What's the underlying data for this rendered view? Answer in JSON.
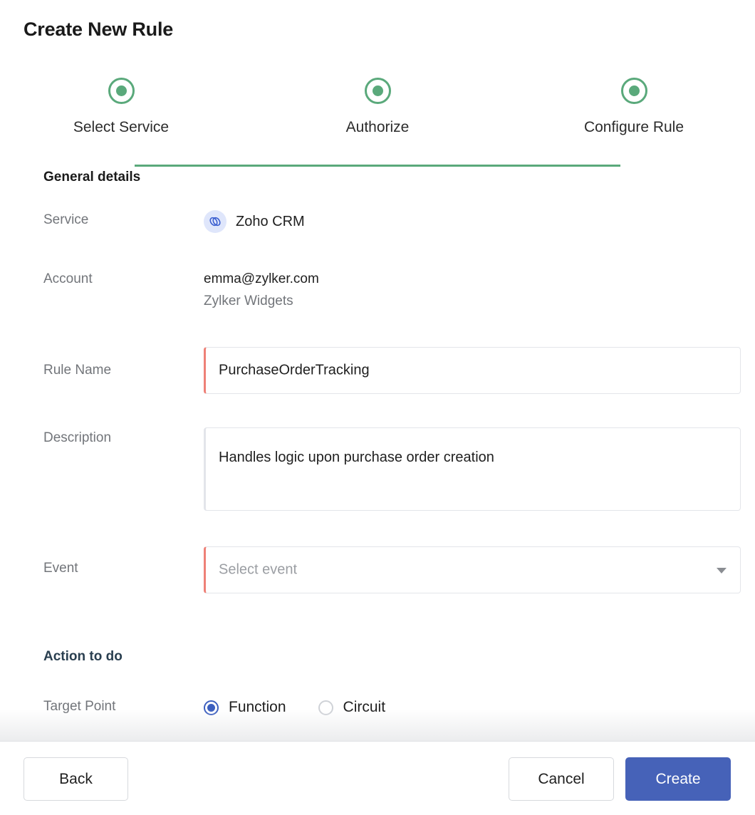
{
  "page": {
    "title": "Create New Rule"
  },
  "stepper": {
    "steps": [
      {
        "label": "Select Service",
        "state": "complete"
      },
      {
        "label": "Authorize",
        "state": "complete"
      },
      {
        "label": "Configure Rule",
        "state": "complete"
      }
    ],
    "accent_color": "#5aa97b"
  },
  "general": {
    "heading": "General details",
    "service": {
      "label": "Service",
      "icon": "link-chain-icon",
      "value": "Zoho CRM"
    },
    "account": {
      "label": "Account",
      "email": "emma@zylker.com",
      "organization": "Zylker Widgets"
    },
    "rule_name": {
      "label": "Rule Name",
      "value": "PurchaseOrderTracking",
      "required": true
    },
    "description": {
      "label": "Description",
      "value": "Handles logic upon purchase order creation",
      "required": false
    },
    "event": {
      "label": "Event",
      "value": "",
      "placeholder": "Select event",
      "required": true
    }
  },
  "action": {
    "heading": "Action to do",
    "target_point": {
      "label": "Target Point",
      "selected": "Function",
      "options": [
        {
          "label": "Function",
          "selected": true
        },
        {
          "label": "Circuit",
          "selected": false
        }
      ]
    }
  },
  "footer": {
    "back_label": "Back",
    "cancel_label": "Cancel",
    "create_label": "Create"
  },
  "colors": {
    "stepper_green": "#5aa97b",
    "primary_blue": "#4662b8",
    "required_red": "#ee8077",
    "heading_navy": "#2a3f50",
    "label_gray": "#72757a"
  }
}
